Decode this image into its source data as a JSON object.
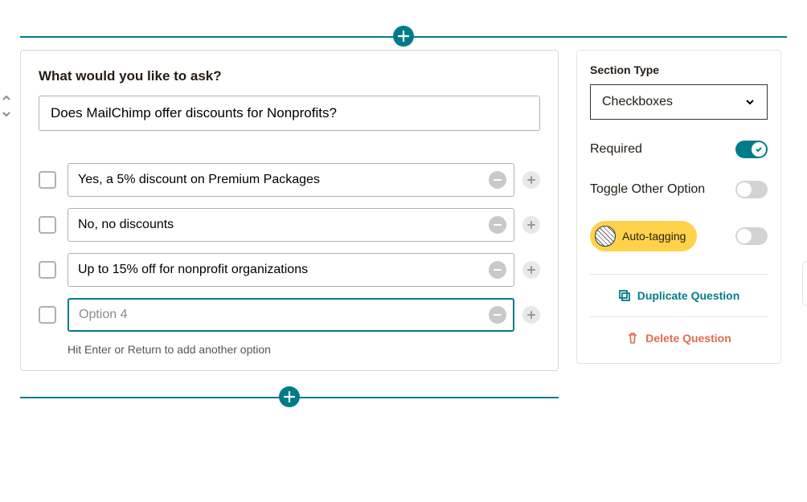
{
  "question": {
    "prompt_label": "What would you like to ask?",
    "prompt_value": "Does MailChimp offer discounts for Nonprofits?",
    "hint": "Hit Enter or Return to add another option",
    "options": [
      {
        "value": "Yes, a 5% discount on Premium Packages",
        "placeholder": ""
      },
      {
        "value": "No, no discounts",
        "placeholder": ""
      },
      {
        "value": "Up to 15% off for nonprofit organizations",
        "placeholder": ""
      },
      {
        "value": "",
        "placeholder": "Option 4"
      }
    ]
  },
  "panel": {
    "section_type_label": "Section Type",
    "section_type_value": "Checkboxes",
    "required_label": "Required",
    "required_on": true,
    "other_label": "Toggle Other Option",
    "other_on": false,
    "autotag_label": "Auto-tagging",
    "autotag_on": false,
    "duplicate_label": "Duplicate Question",
    "delete_label": "Delete Question"
  }
}
